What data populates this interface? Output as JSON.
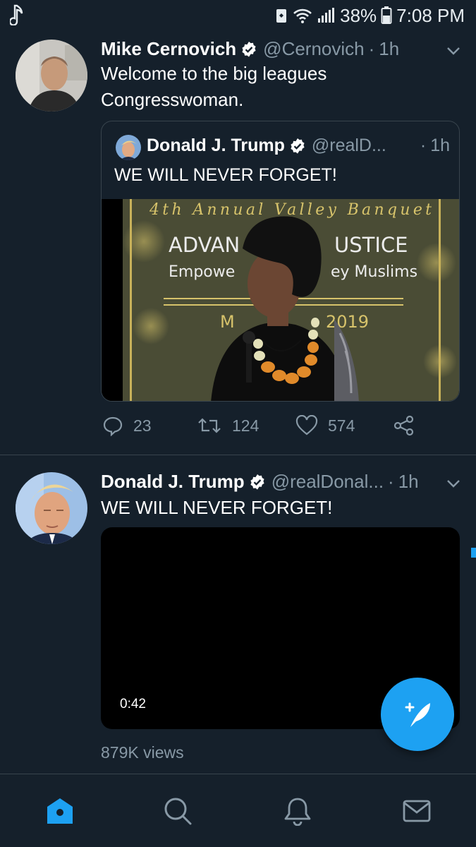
{
  "status_bar": {
    "left_icon": "music-note-icon",
    "battery_percent": "38%",
    "time": "7:08 PM"
  },
  "tweets": [
    {
      "name": "Mike Cernovich",
      "handle": "@Cernovich",
      "separator": "·",
      "time": "1h",
      "text": "Welcome to the big leagues Congresswoman.",
      "quoted": {
        "name": "Donald J. Trump",
        "handle": "@realD...",
        "separator": "·",
        "time": "1h",
        "text": "WE WILL NEVER FORGET!",
        "media_texts": {
          "banner_top": "4th Annual Valley Banquet",
          "headline_left": "ADVAN",
          "headline_right": "USTICE",
          "sub_left": "Empowe",
          "sub_right": "ey Muslims",
          "date_left": "M",
          "date_right": "2019"
        }
      },
      "actions": {
        "replies": "23",
        "retweets": "124",
        "likes": "574"
      }
    },
    {
      "name": "Donald J. Trump",
      "handle": "@realDonal...",
      "separator": "·",
      "time": "1h",
      "text": "WE WILL NEVER FORGET!",
      "video_duration": "0:42",
      "views": "879K views"
    }
  ],
  "fab": {
    "icon": "compose-tweet-icon"
  },
  "nav": {
    "items": [
      "home-icon",
      "search-icon",
      "notifications-icon",
      "messages-icon"
    ],
    "active": "home-icon"
  },
  "colors": {
    "background": "#15202b",
    "accent": "#1da1f2",
    "muted_text": "#8899a6",
    "divider": "#38444d"
  }
}
